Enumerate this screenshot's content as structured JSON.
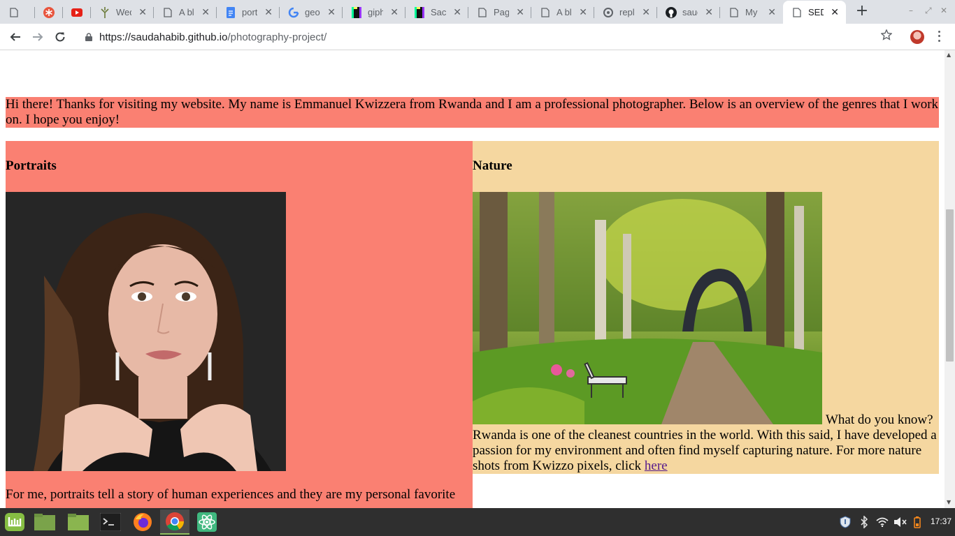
{
  "browser": {
    "tabs": [
      {
        "title": "",
        "icon": "page-icon"
      },
      {
        "title": "",
        "icon": "asterisk-icon"
      },
      {
        "title": "",
        "icon": "youtube-icon"
      },
      {
        "title": "Wed",
        "icon": "tree-icon"
      },
      {
        "title": "A blo",
        "icon": "page-icon"
      },
      {
        "title": "portf",
        "icon": "docs-icon"
      },
      {
        "title": "geor",
        "icon": "google-icon"
      },
      {
        "title": "giph",
        "icon": "giphy-icon"
      },
      {
        "title": "Sacr",
        "icon": "giphy-icon"
      },
      {
        "title": "Page",
        "icon": "page-icon"
      },
      {
        "title": "A blo",
        "icon": "page-icon"
      },
      {
        "title": "repl",
        "icon": "replit-icon"
      },
      {
        "title": "saud",
        "icon": "github-icon"
      },
      {
        "title": "My P",
        "icon": "page-icon"
      },
      {
        "title": "SED",
        "icon": "page-icon",
        "active": true
      }
    ],
    "url_host": "https://saudahabib.github.io",
    "url_path": "/photography-project/"
  },
  "page": {
    "intro": "Hi there! Thanks for visiting my website. My name is Emmanuel Kwizzera from Rwanda and I am a professional photographer. Below is an overview of the genres that I work on. I hope you enjoy!",
    "portraits": {
      "heading": "Portraits",
      "body": "For me, portraits tell a story of human experiences and they are my personal favorite"
    },
    "nature": {
      "heading": "Nature",
      "body": "What do you know? Rwanda is one of the cleanest countries in the world. With this said, I have developed a passion for my environment and often find myself capturing nature. For more nature shots from Kwizzo pixels, click",
      "link": "here"
    }
  },
  "taskbar": {
    "apps": [
      "mint-menu-icon",
      "files-icon",
      "folder-icon",
      "terminal-icon",
      "firefox-icon",
      "chrome-icon",
      "atom-icon"
    ],
    "tray": [
      "shield-icon",
      "bluetooth-icon",
      "wifi-icon",
      "volume-icon",
      "battery-icon"
    ],
    "clock": "17:37"
  },
  "colors": {
    "salmon": "#fa8072",
    "wheat": "#f5d7a0",
    "link": "#551a8b"
  }
}
